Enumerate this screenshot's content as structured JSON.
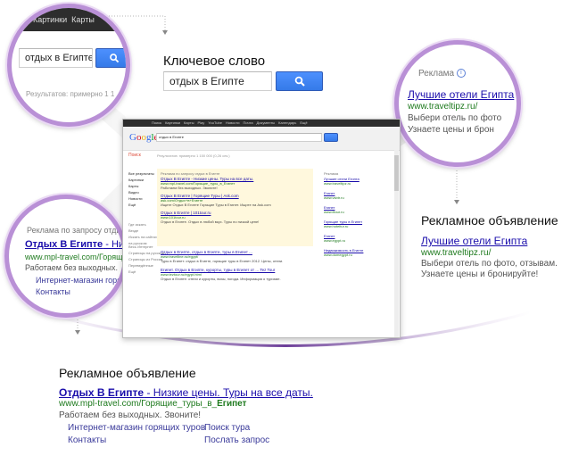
{
  "keyword_section": {
    "title": "Ключевое слово",
    "query": "отдых в Египте"
  },
  "circle_top_left": {
    "tab_text": "Картинки  Карты",
    "query": "отдых в Египте",
    "results_text": "Результатов: примерно 1 1"
  },
  "circle_top_right": {
    "ad_label": "Реклама",
    "ad_title": "Лучшие отели Египта",
    "ad_url": "www.traveltipz.ru/",
    "ad_desc_1": "Выбери отель по фото",
    "ad_desc_2": "Узнаете цены и брон"
  },
  "circle_left": {
    "ad_label": "Реклама по запросу отдых",
    "ad_title_bold": "Отдых В Египте",
    "ad_title_rest": " - Низк",
    "ad_url": "www.mpl-travel.com/Горящи",
    "ad_desc": "Работаем без выходных.",
    "sitelink_1": "Интернет-магазин горя",
    "sitelink_2": "Контакты"
  },
  "right_ad": {
    "heading": "Рекламное объявление",
    "title": "Лучшие отели Египта",
    "url": "www.traveltipz.ru/",
    "desc_1": "Выбери отель по фото, отзывам.",
    "desc_2": "Узнаете цены и бронируйте!"
  },
  "bottom_ad": {
    "heading": "Рекламное объявление",
    "title_bold": "Отдых В Египте",
    "title_rest": " - Низкие цены. Туры на все даты.",
    "url_prefix": "www.mpl-travel.com/Горящие_туры_в_",
    "url_bold": "Египет",
    "desc": "Работаем без выходных. Звоните!",
    "sitelink_1": "Интернет-магазин горящих туров",
    "sitelink_2": "Поиск тура",
    "sitelink_3": "Контакты",
    "sitelink_4": "Послать запрос"
  },
  "screenshot": {
    "topbar_items": [
      "Поиск",
      "Картинки",
      "Карты",
      "Play",
      "YouTube",
      "Новости",
      "Почта",
      "Документы",
      "Календарь",
      "Ещё"
    ],
    "logo_letters": [
      "G",
      "o",
      "o",
      "g",
      "l",
      "e"
    ],
    "query": "отдых в Египте",
    "left_title": "Поиск",
    "results_count": "Результатов: примерно 1 150 000 (0,26 сек.)",
    "left_nav": [
      "Все результаты",
      "Картинки",
      "Карты",
      "Видео",
      "Новости",
      "Ещё"
    ],
    "left_nav_2": [
      "Где искать",
      "Везде",
      "Искать на сайтах",
      "на русском"
    ],
    "left_nav_3": [
      "Весь Интернет",
      "Страницы на русском",
      "Страницы из России",
      "Переведённые",
      "Ещё"
    ],
    "top_ads_label": "Реклама по запросу отдых в Египте",
    "top_ads": [
      {
        "title": "Отдых В Египте - Низкие цены. Туры на все даты.",
        "url": "www.mpl-travel.com/Горящие_туры_в_Египет",
        "desc": "Работаем без выходных. Звоните!"
      },
      {
        "title": "Отдых В Египте | Горящие Туры | Ask.com",
        "url": "ask.com/Отдых+в+Египте",
        "desc": "Ищите Отдых В Египте Горящие Туры в Египет. Ищите на Ask.com"
      },
      {
        "title": "Отдых в Египте | 101tour.ru",
        "url": "www.101tour.ru",
        "desc": "Отдых в Египте. Отдых в любой вкус. Туры по низкой цене!"
      }
    ],
    "organic": [
      {
        "title": "Отдых в Египте, отдых в Египте, туры в Египет ...",
        "url": "www.travelline.ru/egypt/",
        "desc": "Туры в Египет: отдых в Египте, горящие туры в Египет 2012. Цены, отели."
      },
      {
        "title": "Египет. Отдых в Египте, курорты, туры в Египет от ... Tez Tour",
        "url": "www.teztour.ru/egypt.html",
        "desc": "Отдых в Египте: отели и курорты, визы, погода. Информация о туризме."
      }
    ],
    "right_ads": [
      {
        "title": "Лучшие отели Египта",
        "url": "www.traveltipz.ru"
      },
      {
        "title": "Египет",
        "url": "www.vsbtr.ru"
      },
      {
        "title": "Египет",
        "url": "www.lltour.ru"
      },
      {
        "title": "Горящие туры в Египет",
        "url": "www.hoteltur.ru"
      },
      {
        "title": "Египет",
        "url": "www.egypt.ru"
      },
      {
        "title": "Недвижимость в Египте",
        "url": "www.domegypt.ru"
      }
    ]
  }
}
